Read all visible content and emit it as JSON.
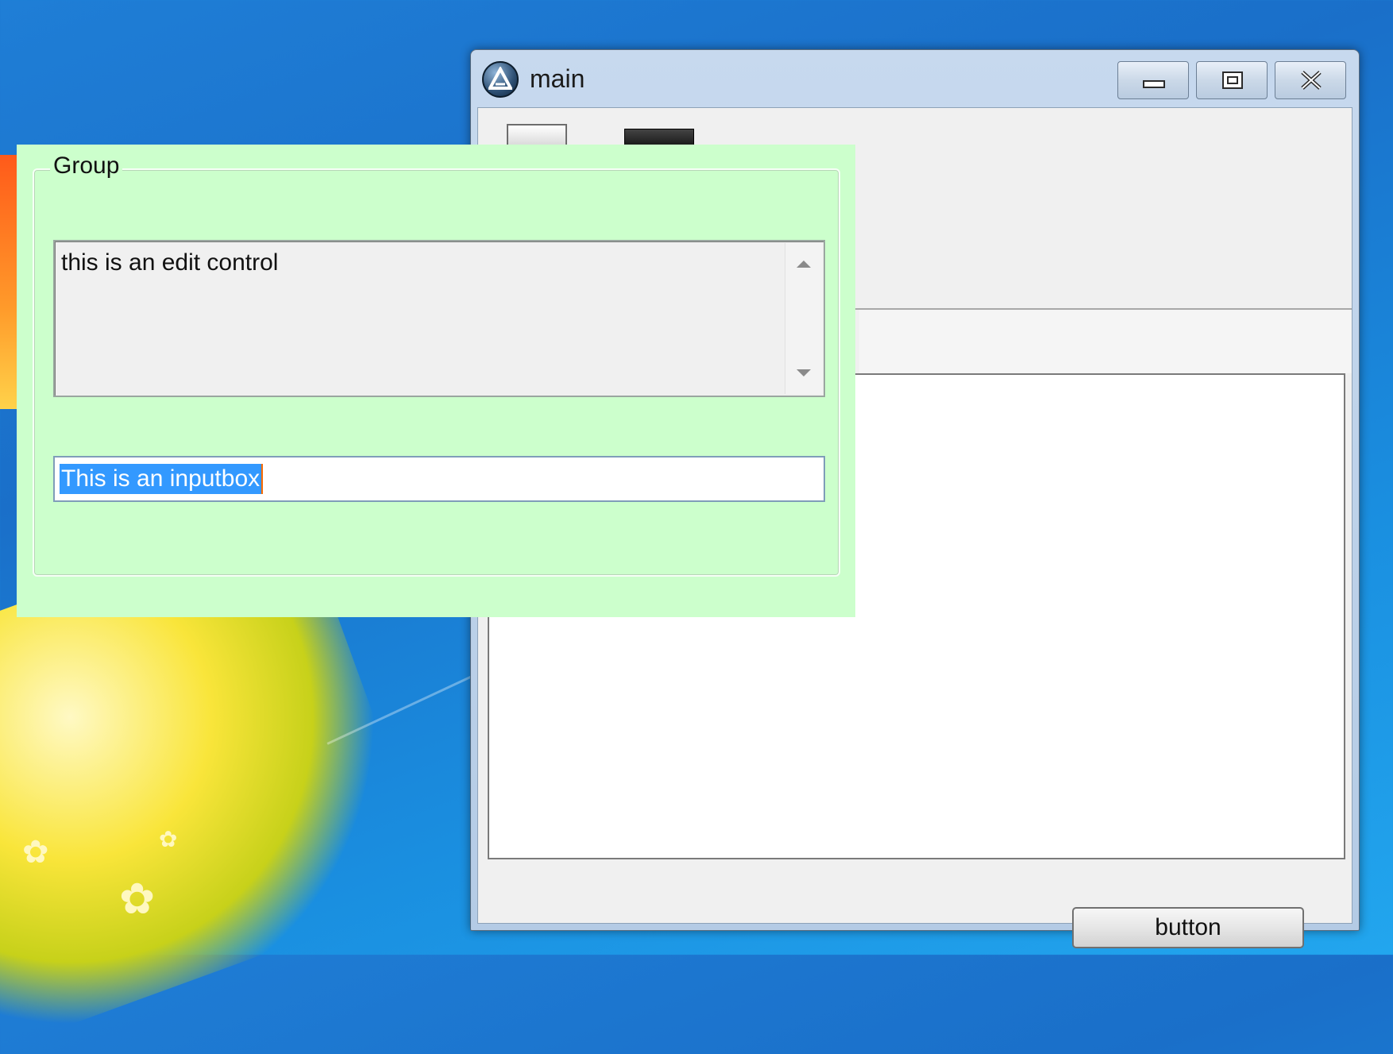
{
  "window": {
    "title": "main",
    "minimize_icon": "minimize-icon",
    "maximize_icon": "maximize-icon",
    "close_icon": "close-icon"
  },
  "main": {
    "button_label": "button"
  },
  "group": {
    "label": "Group",
    "edit_text": "this is an edit control",
    "input_value": "This is an inputbox"
  },
  "colors": {
    "group_background": "#ccffcc",
    "selection": "#3399ff",
    "desktop": "#1a7fd8"
  }
}
